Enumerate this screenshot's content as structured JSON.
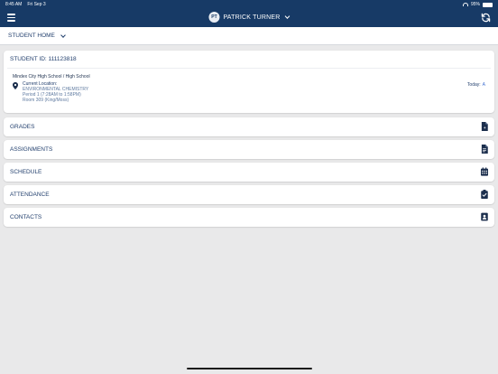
{
  "status_bar": {
    "time": "8:45 AM",
    "date": "Fri Sep 3",
    "battery_text": "95%",
    "battery_level": 0.95
  },
  "nav": {
    "avatar_initials": "PT",
    "user_name": "PATRICK TURNER",
    "menu_icon": "hamburger-icon",
    "refresh_icon": "refresh-icon"
  },
  "subnav": {
    "label": "STUDENT HOME"
  },
  "student_card": {
    "student_id": "STUDENT ID: 111123818",
    "school": "Mindex City High School / High School",
    "location_label": "Current Location:",
    "course": "ENVIRONMENTAL CHEMISTRY",
    "period": "Period 1 (7:28AM to 1:58PM)",
    "room": "Room 309 (King/Moss)",
    "today_label": "Today:",
    "today_grade": "A"
  },
  "sections": [
    {
      "label": "GRADES",
      "icon": "grades-icon"
    },
    {
      "label": "ASSIGNMENTS",
      "icon": "assignments-icon"
    },
    {
      "label": "SCHEDULE",
      "icon": "calendar-icon"
    },
    {
      "label": "ATTENDANCE",
      "icon": "attendance-check-icon"
    },
    {
      "label": "CONTACTS",
      "icon": "contact-card-icon"
    }
  ],
  "colors": {
    "nav_bg": "#173a66",
    "text_primary": "#23406e",
    "background": "#e9e9ea",
    "card_bg": "#ffffff"
  }
}
